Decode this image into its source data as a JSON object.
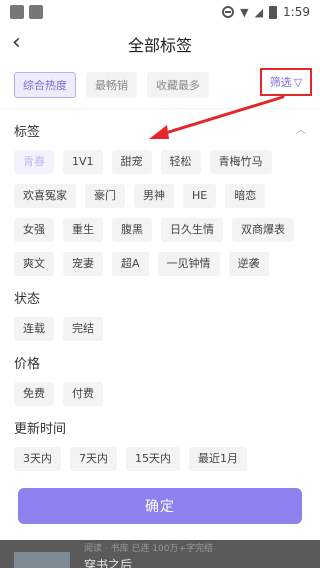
{
  "status": {
    "time": "1:59"
  },
  "nav": {
    "title": "全部标签"
  },
  "sort_tabs": [
    {
      "label": "综合热度",
      "active": true
    },
    {
      "label": "最畅销",
      "active": false
    },
    {
      "label": "收藏最多",
      "active": false
    }
  ],
  "filter": {
    "label": "筛选",
    "icon": "funnel-icon",
    "highlight_color": "#e5262a"
  },
  "sections": {
    "tags": {
      "title": "标签",
      "items": [
        "青春",
        "1V1",
        "甜宠",
        "轻松",
        "青梅竹马",
        "欢喜冤家",
        "豪门",
        "男神",
        "HE",
        "暗恋",
        "女强",
        "重生",
        "腹黑",
        "日久生情",
        "双商爆表",
        "爽文",
        "宠妻",
        "超A",
        "一见钟情",
        "逆袭"
      ],
      "selected": "青春"
    },
    "status": {
      "title": "状态",
      "items": [
        "连载",
        "完结"
      ]
    },
    "price": {
      "title": "价格",
      "items": [
        "免费",
        "付费"
      ]
    },
    "update": {
      "title": "更新时间",
      "items": [
        "3天内",
        "7天内",
        "15天内",
        "最近1月"
      ]
    }
  },
  "confirm": {
    "label": "确定"
  },
  "behind": {
    "line1": "阅读 · 书库 已连 100万+字完结",
    "line2": "穿书之后"
  },
  "colors": {
    "accent": "#8e80ee",
    "chip_bg": "#f3f3f3",
    "annotation_red": "#e5262a"
  }
}
